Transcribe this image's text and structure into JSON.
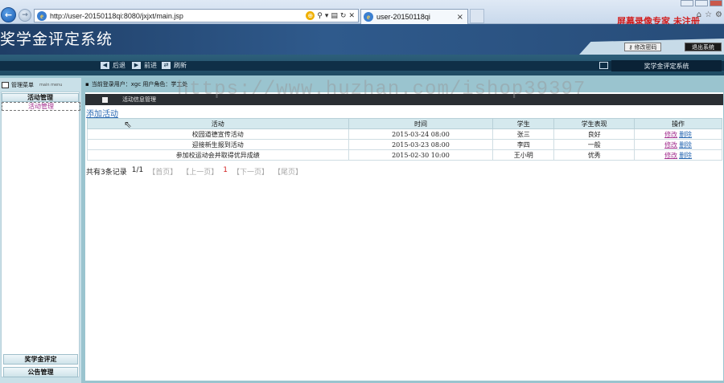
{
  "browser": {
    "url": "http://user-20150118qi:8080/jxjxt/main.jsp",
    "tab_title": "user-20150118qi",
    "tab_close": "×",
    "overlay_text": "屏幕录像专家  未注册"
  },
  "header": {
    "app_title": "奖学金评定系统",
    "change_password": "修改密码",
    "logout": "退出系统"
  },
  "toolbar": {
    "back": "后退",
    "forward": "前进",
    "refresh": "刷新",
    "system_tag": "奖学金评定系统"
  },
  "sidebar": {
    "title": "管理菜单",
    "subtitle": "main menu",
    "group_activity": "活动管理",
    "link_activity": "活动管理",
    "group_scholarship": "奖学金评定",
    "group_notice": "公告管理"
  },
  "main": {
    "login_info": "当前登录用户：xgc  用户角色：学工处",
    "panel_title": "活动信息管理",
    "add_link": "添加活动",
    "table": {
      "headers": [
        "活动",
        "时间",
        "学生",
        "学生表现",
        "操作"
      ],
      "rows": [
        {
          "activity": "校园道德宣传活动",
          "time": "2015-03-24 08:00",
          "student": "张三",
          "performance": "良好"
        },
        {
          "activity": "迎接新生报到活动",
          "time": "2015-03-23 08:00",
          "student": "李四",
          "performance": "一般"
        },
        {
          "activity": "参加校运动会并取得优异成绩",
          "time": "2015-02-30 10:00",
          "student": "王小明",
          "performance": "优秀"
        }
      ],
      "edit_label": "修改",
      "delete_label": "删除"
    },
    "pager": {
      "total": "共有3条记录",
      "page_of": "1/1",
      "first": "【首页】",
      "prev": "【上一页】",
      "current": "1",
      "next": "【下一页】",
      "last": "【尾页】"
    }
  },
  "watermark": "https://www.huzhan.com/ishop39397"
}
